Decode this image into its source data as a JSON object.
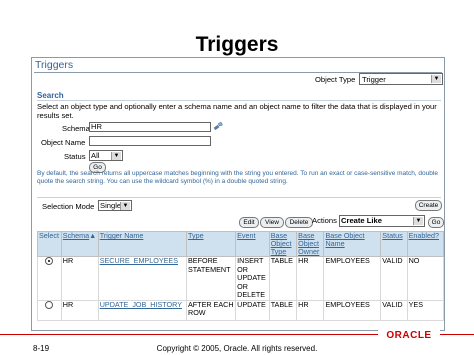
{
  "slide": {
    "title": "Triggers",
    "page_number": "8-19",
    "copyright": "Copyright © 2005, Oracle.  All rights reserved.",
    "logo_text": "ORACLE"
  },
  "panel": {
    "title": "Triggers",
    "object_type_label": "Object Type",
    "object_type_value": "Trigger"
  },
  "search": {
    "heading": "Search",
    "description": "Select an object type and optionally enter a schema name and an object name to filter the data that is displayed in your results set.",
    "schema_label": "Schema",
    "schema_value": "HR",
    "object_name_label": "Object Name",
    "object_name_value": "",
    "status_label": "Status",
    "status_value": "All",
    "go_label": "Go",
    "tip": "By default, the search returns all uppercase matches beginning with the string you entered. To run an exact or case-sensitive match, double quote the search string. You can use the wildcard symbol (%) in a double quoted string."
  },
  "selection": {
    "mode_label": "Selection Mode",
    "mode_value": "Single",
    "create_label": "Create"
  },
  "actions": {
    "edit_label": "Edit",
    "view_label": "View",
    "delete_label": "Delete",
    "actions_label": "Actions",
    "actions_value": "Create Like",
    "go_label": "Go"
  },
  "table": {
    "headers": {
      "select": "Select",
      "schema": "Schema",
      "trigger_name": "Trigger Name",
      "type": "Type",
      "event": "Event",
      "base_object_type": "Base Object Type",
      "base_object_owner": "Base Object Owner",
      "base_object_name": "Base Object Name",
      "status": "Status",
      "enabled": "Enabled?"
    },
    "rows": [
      {
        "schema": "HR",
        "trigger_name": "SECURE_EMPLOYEES",
        "type": "BEFORE STATEMENT",
        "event": "INSERT OR UPDATE OR DELETE",
        "base_object_type": "TABLE",
        "base_object_owner": "HR",
        "base_object_name": "EMPLOYEES",
        "status": "VALID",
        "enabled": "NO",
        "selected": true
      },
      {
        "schema": "HR",
        "trigger_name": "UPDATE_JOB_HISTORY",
        "type": "AFTER EACH ROW",
        "event": "UPDATE",
        "base_object_type": "TABLE",
        "base_object_owner": "HR",
        "base_object_name": "EMPLOYEES",
        "status": "VALID",
        "enabled": "YES",
        "selected": false
      }
    ]
  },
  "colors": {
    "accent": "#336699",
    "header_bg": "#cfe0ee",
    "brand_red": "#cc0000"
  }
}
